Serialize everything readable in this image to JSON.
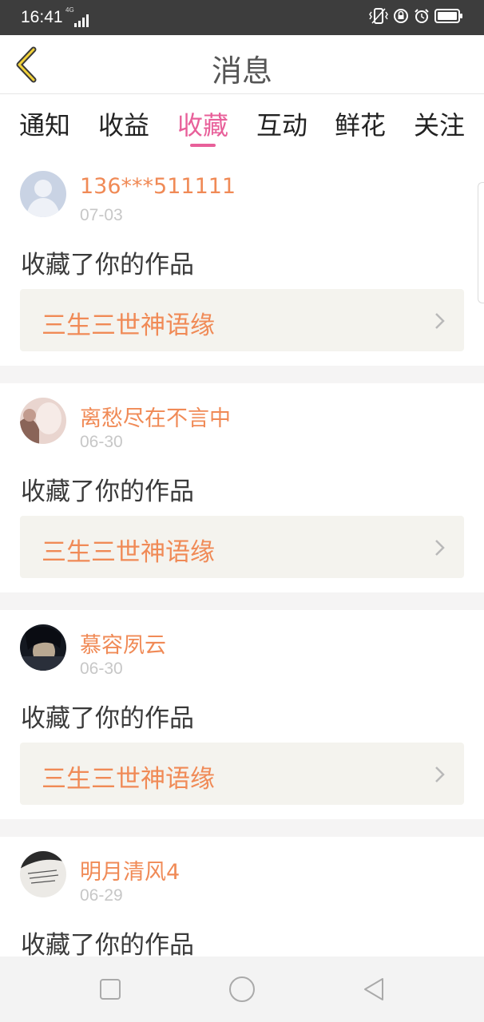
{
  "status_bar": {
    "time": "16:41",
    "network": "4G",
    "icons": [
      "signal-icon",
      "vibrate-icon",
      "lock-rotation-icon",
      "alarm-icon",
      "battery-icon"
    ]
  },
  "header": {
    "title": "消息",
    "back_icon": "chevron-left-icon"
  },
  "tabs": [
    {
      "label": "通知",
      "active": false
    },
    {
      "label": "收益",
      "active": false
    },
    {
      "label": "收藏",
      "active": true
    },
    {
      "label": "互动",
      "active": false
    },
    {
      "label": "鲜花",
      "active": false
    },
    {
      "label": "关注",
      "active": false
    }
  ],
  "colors": {
    "accent": "#e8609a",
    "name": "#f08a56",
    "work_bg": "#f4f3ee",
    "status_bar": "#3d3d3d"
  },
  "messages": [
    {
      "user": "136***511111",
      "date": "07-03",
      "action": "收藏了你的作品",
      "work": "三生三世神语缘",
      "avatar": "default-avatar-icon"
    },
    {
      "user": "离愁尽在不言中",
      "date": "06-30",
      "action": "收藏了你的作品",
      "work": "三生三世神语缘",
      "avatar": "user-photo-avatar"
    },
    {
      "user": "慕容夙云",
      "date": "06-30",
      "action": "收藏了你的作品",
      "work": "三生三世神语缘",
      "avatar": "user-photo-avatar"
    },
    {
      "user": "明月清风4",
      "date": "06-29",
      "action": "收藏了你的作品",
      "work": "",
      "avatar": "user-photo-avatar"
    }
  ],
  "nav_bar": {
    "icons": [
      "recents-square-icon",
      "home-circle-icon",
      "back-triangle-icon"
    ]
  }
}
